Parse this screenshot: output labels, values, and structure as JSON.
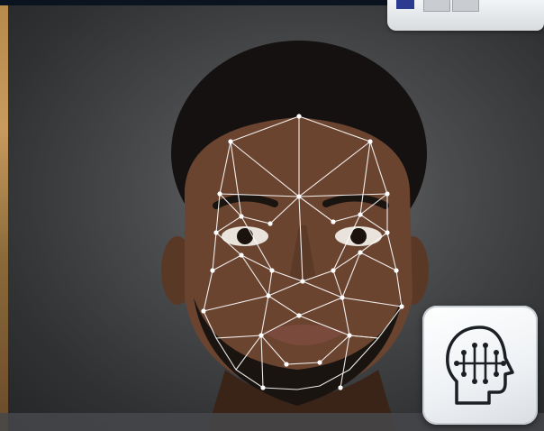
{
  "image": {
    "subject": "face-recognition-portrait",
    "overlay": "facial-landmark-mesh",
    "icon": "ai-head-circuit-icon",
    "colors": {
      "mesh": "#ffffff",
      "background": "#3b3d3f",
      "tile": "#eef1f4",
      "icon_stroke": "#1c1f24"
    }
  }
}
